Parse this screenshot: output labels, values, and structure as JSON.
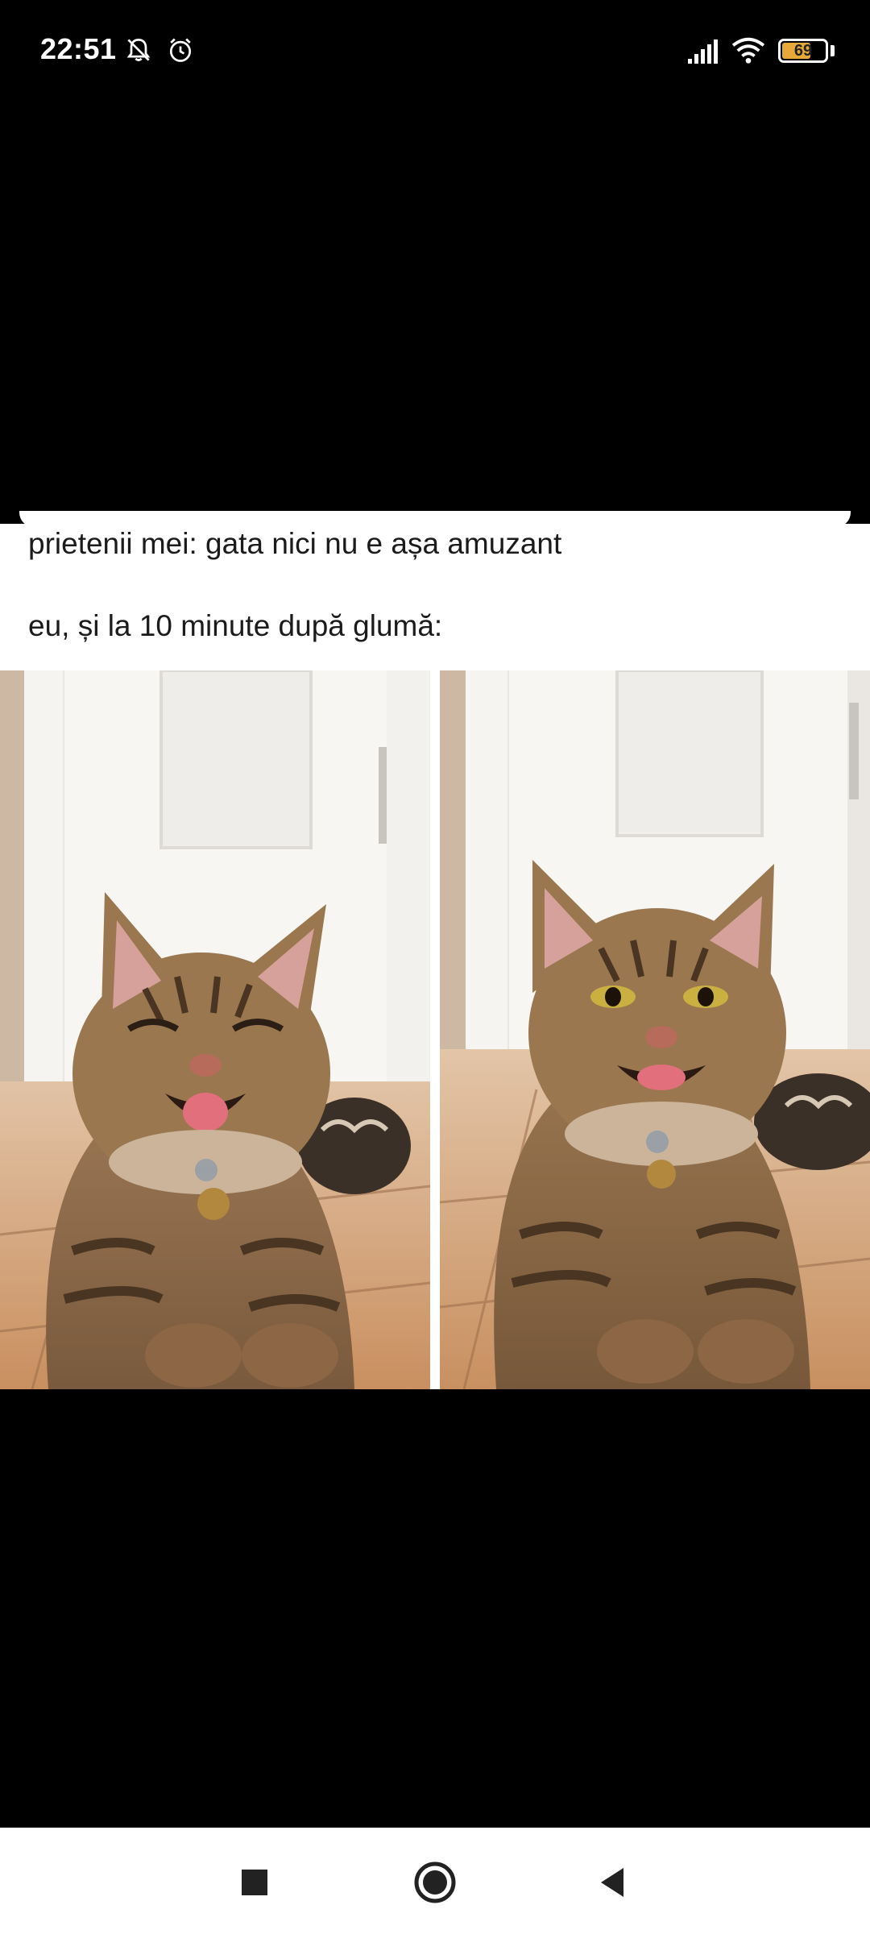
{
  "status_bar": {
    "time": "22:51",
    "icons_left": [
      "notifications-off-icon",
      "alarm-icon"
    ],
    "icons_right": [
      "signal-icon",
      "wifi-icon",
      "battery-icon"
    ],
    "battery_level": 69,
    "battery_label": "69",
    "battery_color": "#e8a93b"
  },
  "meme": {
    "line1": "prietenii mei: gata nici nu e așa amuzant",
    "line2": "eu, și la 10 minute după glumă:",
    "images": [
      {
        "subject": "laughing-cat-eyes-closed"
      },
      {
        "subject": "smiling-cat-eyes-open"
      }
    ]
  },
  "nav_bar": {
    "buttons": [
      "recents-button",
      "home-button",
      "back-button"
    ]
  },
  "colors": {
    "background": "#000000",
    "card": "#ffffff",
    "text": "#1b1b1b"
  }
}
